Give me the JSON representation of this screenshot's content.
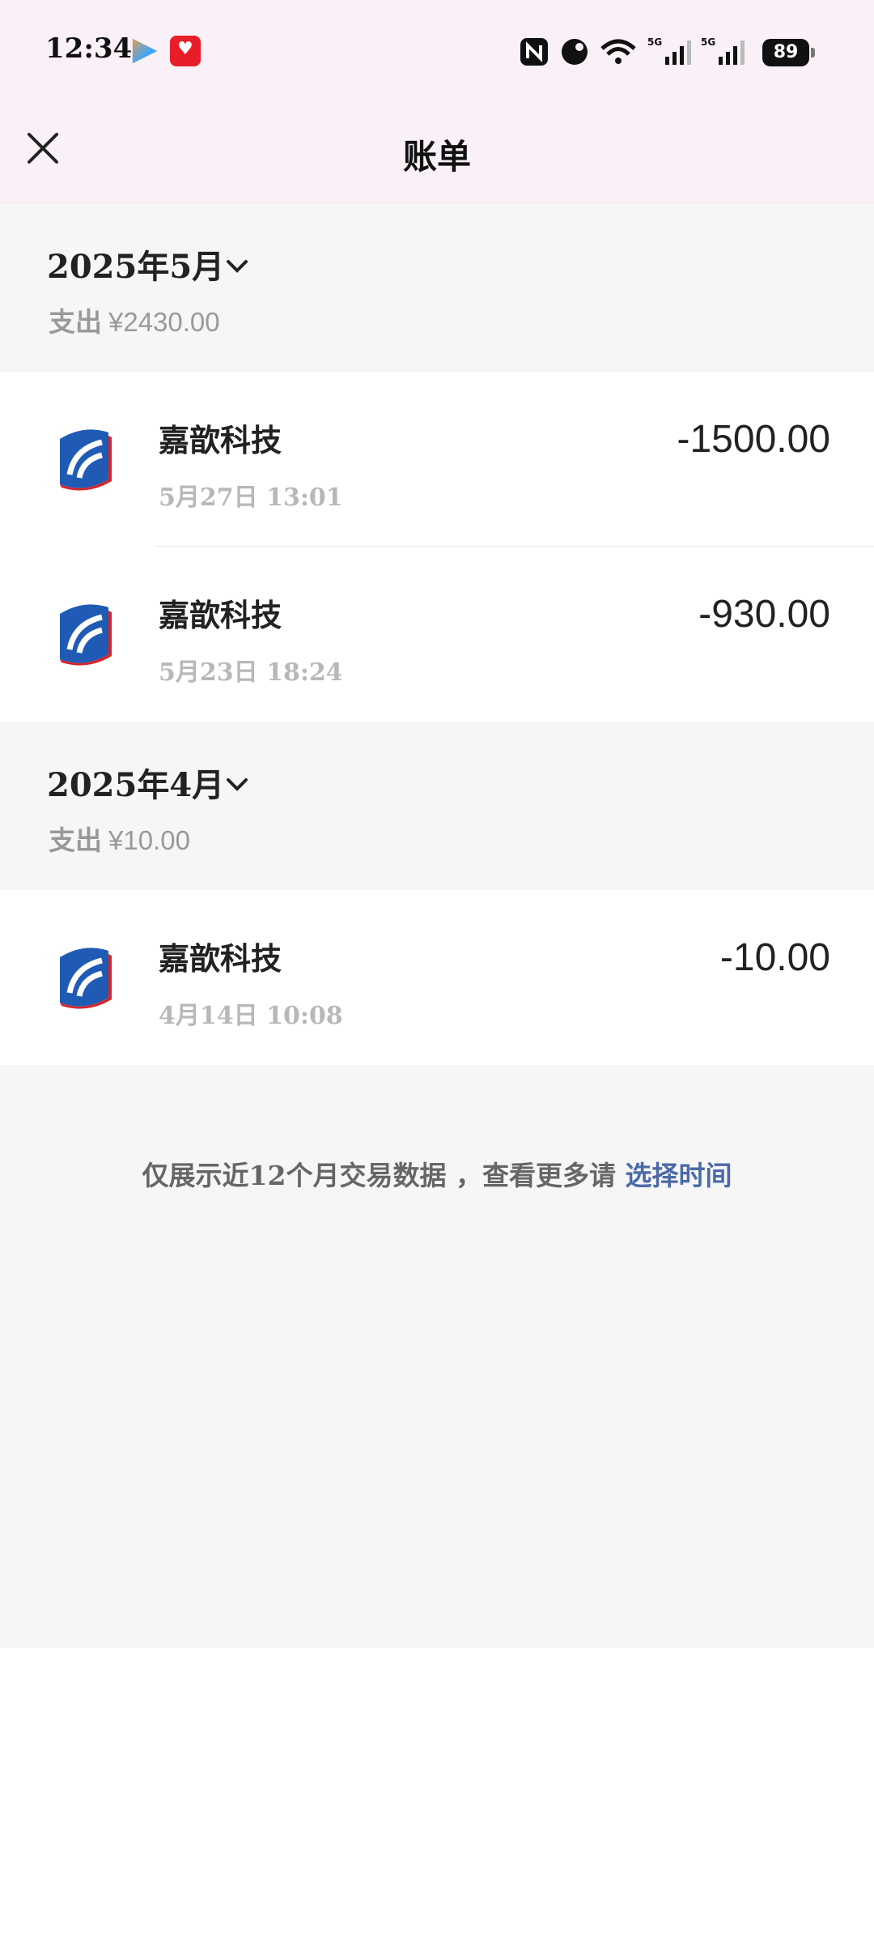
{
  "status_bar": {
    "time": "12:34",
    "app_icons": [
      "video-app-icon",
      "heart-app-icon"
    ],
    "system_icons": [
      "nfc-icon",
      "bluetooth-icon",
      "wifi-icon",
      "signal-5g-icon",
      "signal-5g-icon"
    ],
    "network_label": "5G",
    "battery": "89"
  },
  "header": {
    "title": "账单",
    "close_icon": "close-icon"
  },
  "months": [
    {
      "title": "2025年5月",
      "expense_label": "支出",
      "expense_amount": "¥2430.00",
      "transactions": [
        {
          "merchant": "嘉歆科技",
          "datetime": "5月27日 13:01",
          "amount": "-1500.00"
        },
        {
          "merchant": "嘉歆科技",
          "datetime": "5月23日 18:24",
          "amount": "-930.00"
        }
      ]
    },
    {
      "title": "2025年4月",
      "expense_label": "支出",
      "expense_amount": "¥10.00",
      "transactions": [
        {
          "merchant": "嘉歆科技",
          "datetime": "4月14日 10:08",
          "amount": "-10.00"
        }
      ]
    }
  ],
  "footer": {
    "note": "仅展示近12个月交易数据 ，查看更多请 ",
    "link": "选择时间"
  },
  "colors": {
    "header_bg": "#f9f1f7",
    "section_bg": "#f6f6f6",
    "link": "#4b6aa8",
    "logo_blue": "#1f5bb5",
    "logo_red": "#d8232a"
  }
}
